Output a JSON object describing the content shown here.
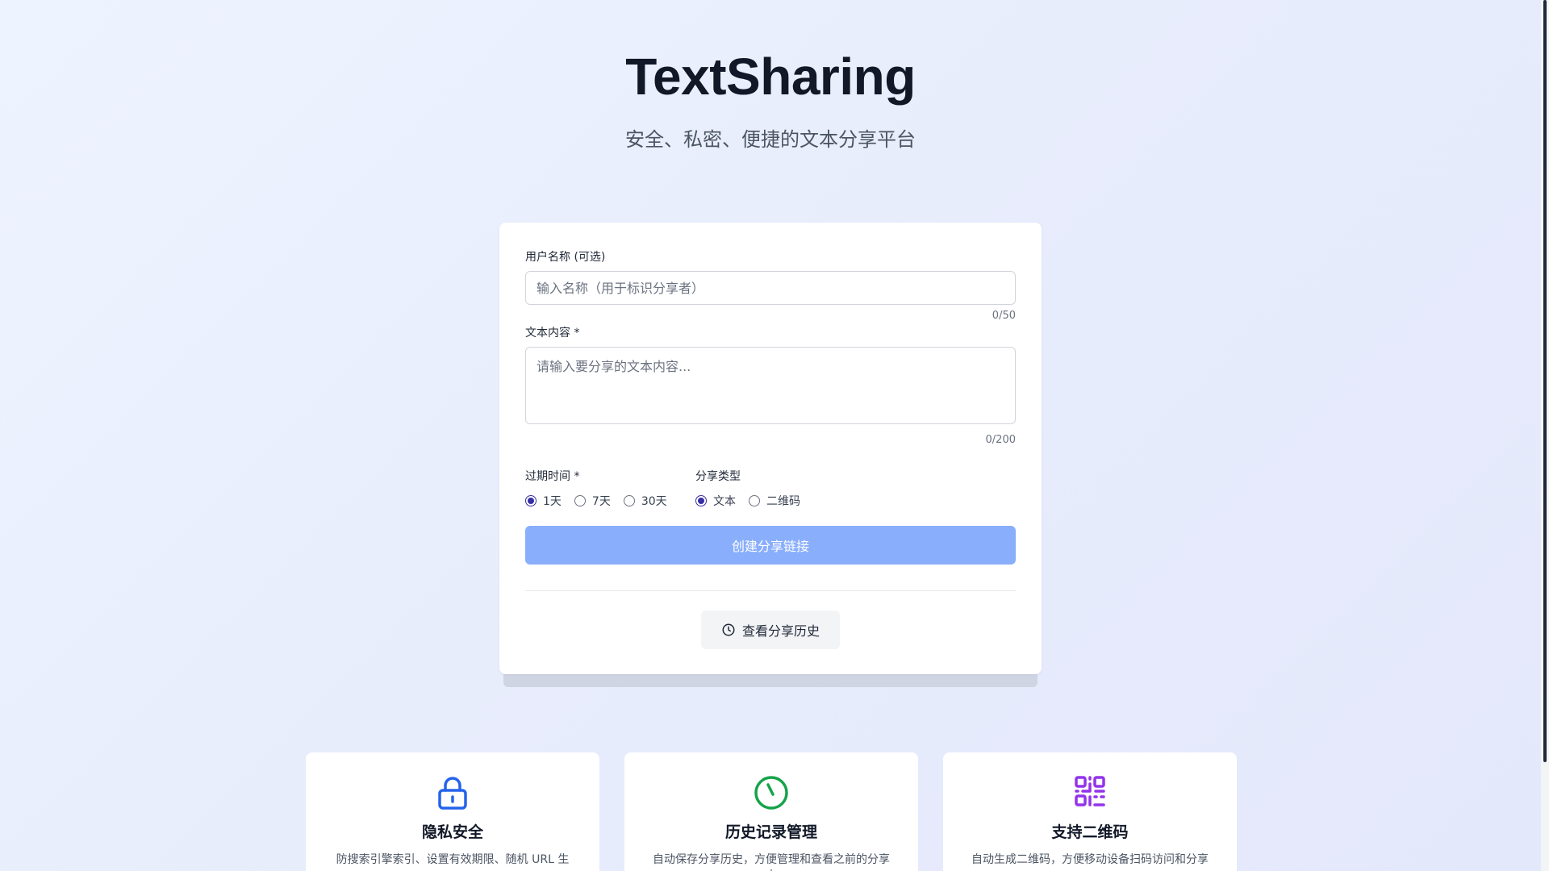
{
  "hero": {
    "title": "TextSharing",
    "subtitle": "安全、私密、便捷的文本分享平台"
  },
  "form": {
    "username_label": "用户名称 (可选)",
    "username_placeholder": "输入名称（用于标识分享者）",
    "username_value": "",
    "username_count": "0/50",
    "content_label": "文本内容 *",
    "content_placeholder": "请输入要分享的文本内容...",
    "content_value": "",
    "content_count": "0/200",
    "expiry_label": "过期时间 *",
    "expiry_options": [
      "1天",
      "7天",
      "30天"
    ],
    "expiry_selected": "1天",
    "type_label": "分享类型",
    "type_options": [
      "文本",
      "二维码"
    ],
    "type_selected": "文本",
    "submit_label": "创建分享链接",
    "submit_color": "#89aefb",
    "history_label": "查看分享历史"
  },
  "features": [
    {
      "icon": "lock-icon",
      "color": "#2563eb",
      "title": "隐私安全",
      "desc": "防搜索引擎索引、设置有效期限、随机 URL 生"
    },
    {
      "icon": "clock-icon",
      "color": "#16a34a",
      "title": "历史记录管理",
      "desc": "自动保存分享历史，方便管理和查看之前的分享内"
    },
    {
      "icon": "qrcode-icon",
      "color": "#9333ea",
      "title": "支持二维码",
      "desc": "自动生成二维码，方便移动设备扫码访问和分享"
    }
  ]
}
